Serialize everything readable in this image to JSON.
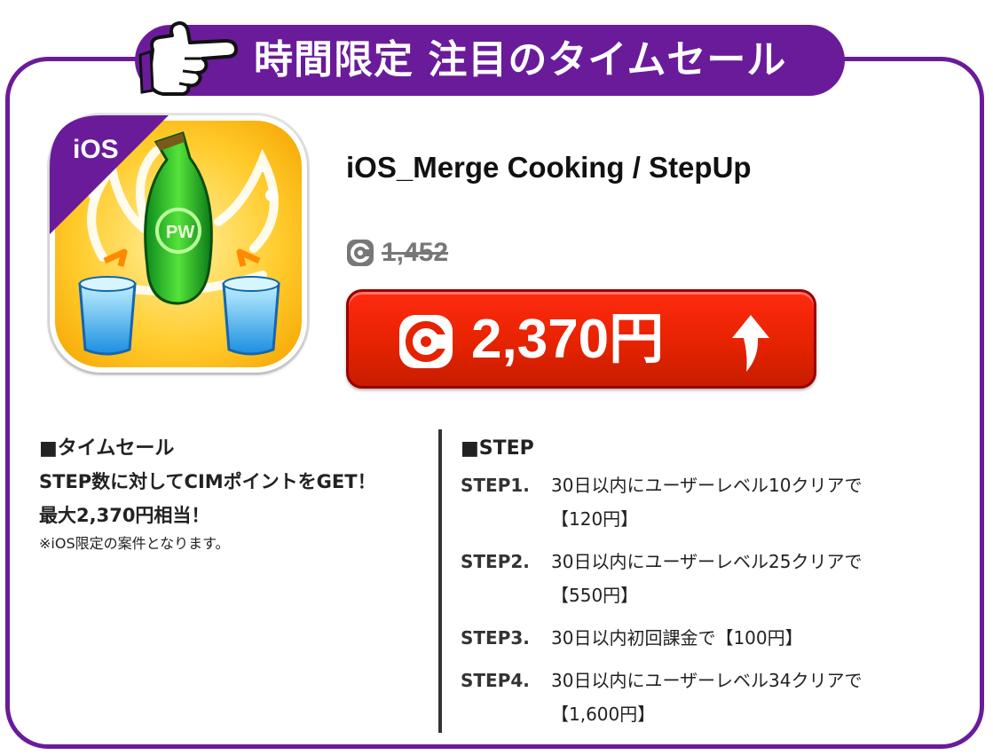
{
  "banner": {
    "title": "時間限定 注目のタイムセール"
  },
  "app": {
    "platform_badge": "iOS",
    "name": "iOS_Merge Cooking / StepUp",
    "old_points": "1,452",
    "new_price": "2,370円"
  },
  "left": {
    "heading": "■タイムセール",
    "line1": "STEP数に対してCIMポイントをGET！",
    "line2": "最大2,370円相当！",
    "note": "※iOS限定の案件となります。"
  },
  "right": {
    "heading": "■STEP",
    "steps": [
      {
        "label": "STEP1.",
        "line1": "30日以内にユーザーレベル10クリアで",
        "line2": "【120円】"
      },
      {
        "label": "STEP2.",
        "line1": "30日以内にユーザーレベル25クリアで",
        "line2": "【550円】"
      },
      {
        "label": "STEP3.",
        "line1": "30日以内初回課金で【100円】",
        "line2": ""
      },
      {
        "label": "STEP4.",
        "line1": "30日以内にユーザーレベル34クリアで",
        "line2": "【1,600円】"
      }
    ]
  },
  "colors": {
    "brand_purple": "#6a1b9a",
    "price_red": "#e62300",
    "icon_yellow": "#ffc61a"
  },
  "icons": [
    "pointing-hand-icon",
    "coin-icon",
    "up-arrow-icon",
    "app-icon"
  ]
}
